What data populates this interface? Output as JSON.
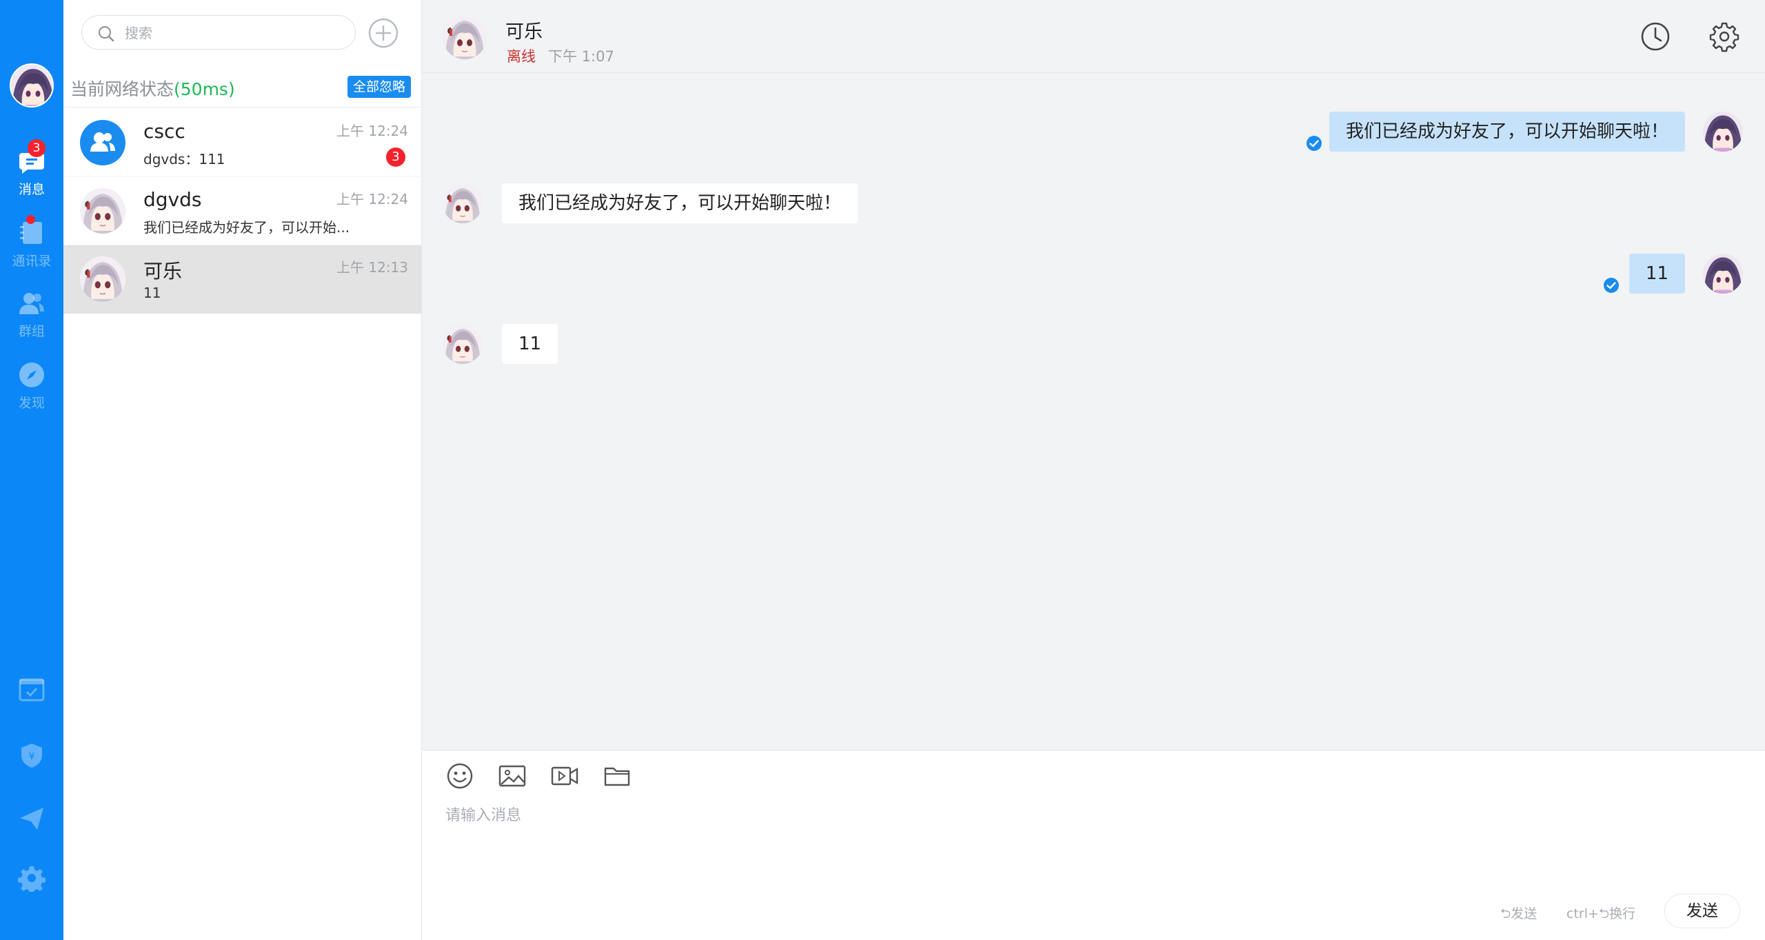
{
  "rail": {
    "nav": [
      {
        "label": "消息",
        "icon": "message-icon",
        "badge": "3",
        "active": true
      },
      {
        "label": "通讯录",
        "icon": "contacts-icon",
        "dot": true
      },
      {
        "label": "群组",
        "icon": "group-icon"
      },
      {
        "label": "发现",
        "icon": "compass-icon"
      }
    ],
    "bottom_icons": [
      "calendar-icon",
      "shield-icon",
      "send-icon",
      "gear-icon"
    ]
  },
  "search": {
    "placeholder": "搜索"
  },
  "network": {
    "label": "当前网络状态",
    "latency": "(50ms)",
    "ignore_all": "全部忽略"
  },
  "conversations": [
    {
      "name": "cscc",
      "time": "上午 12:24",
      "preview": "dgvds：111",
      "badge": "3",
      "avatar": "group-avatar"
    },
    {
      "name": "dgvds",
      "time": "上午 12:24",
      "preview": "我们已经成为好友了，可以开始...",
      "avatar": "anime-avatar"
    },
    {
      "name": "可乐",
      "time": "上午 12:13",
      "preview": "11",
      "avatar": "anime-avatar",
      "selected": true
    }
  ],
  "chat": {
    "name": "可乐",
    "status": "离线",
    "last_seen": "下午 1:07",
    "messages": [
      {
        "direction": "out",
        "text": "我们已经成为好友了，可以开始聊天啦！",
        "read": true
      },
      {
        "direction": "in",
        "text": "我们已经成为好友了，可以开始聊天啦！"
      },
      {
        "direction": "out",
        "text": "11",
        "read": true
      },
      {
        "direction": "in",
        "text": "11"
      }
    ]
  },
  "composer": {
    "placeholder": "请输入消息",
    "tools": [
      "emoji-icon",
      "image-icon",
      "video-icon",
      "folder-icon"
    ],
    "hint_send": "⮌发送",
    "hint_newline": "ctrl+⮌换行",
    "send_label": "发送"
  },
  "colors": {
    "rail": "#0c87f7",
    "accent": "#1a8cf0",
    "outgoing_bubble": "#c6e2fb",
    "badge": "#f5222d",
    "offline": "#c9302c",
    "latency": "#1db954"
  }
}
